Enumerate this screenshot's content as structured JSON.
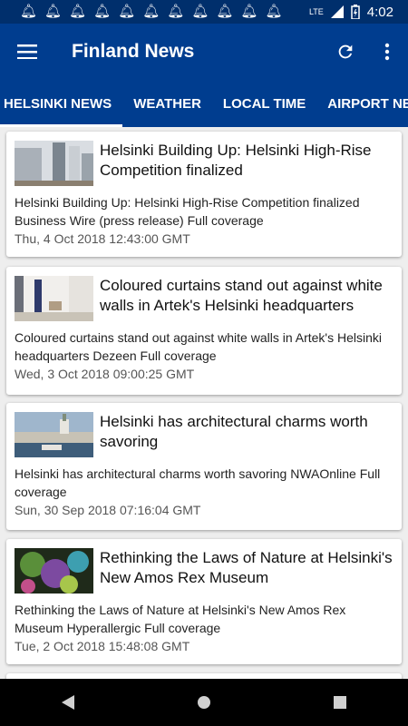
{
  "status_bar": {
    "network": "LTE",
    "time": "4:02"
  },
  "app_bar": {
    "title": "Finland News"
  },
  "tabs": [
    {
      "label": "HELSINKI NEWS"
    },
    {
      "label": "WEATHER"
    },
    {
      "label": "LOCAL TIME"
    },
    {
      "label": "AIRPORT NEWS"
    }
  ],
  "articles": [
    {
      "title": "Helsinki Building Up: Helsinki High-Rise Competition finalized",
      "description": "Helsinki Building Up: Helsinki High-Rise Competition finalized  Business Wire (press release)  Full coverage",
      "date": "Thu, 4 Oct 2018 12:43:00 GMT"
    },
    {
      "title": "Coloured curtains stand out against white walls in Artek's Helsinki headquarters",
      "description": "Coloured curtains stand out against white walls in Artek's Helsinki headquarters  Dezeen  Full coverage",
      "date": "Wed, 3 Oct 2018 09:00:25 GMT"
    },
    {
      "title": "Helsinki has architectural charms worth savoring",
      "description": "Helsinki has architectural charms worth savoring  NWAOnline  Full coverage",
      "date": "Sun, 30 Sep 2018 07:16:04 GMT"
    },
    {
      "title": "Rethinking the Laws of Nature at Helsinki's New Amos Rex Museum",
      "description": "Rethinking the Laws of Nature at Helsinki's New Amos Rex Museum  Hyperallergic  Full coverage",
      "date": "Tue, 2 Oct 2018 15:48:08 GMT"
    }
  ]
}
